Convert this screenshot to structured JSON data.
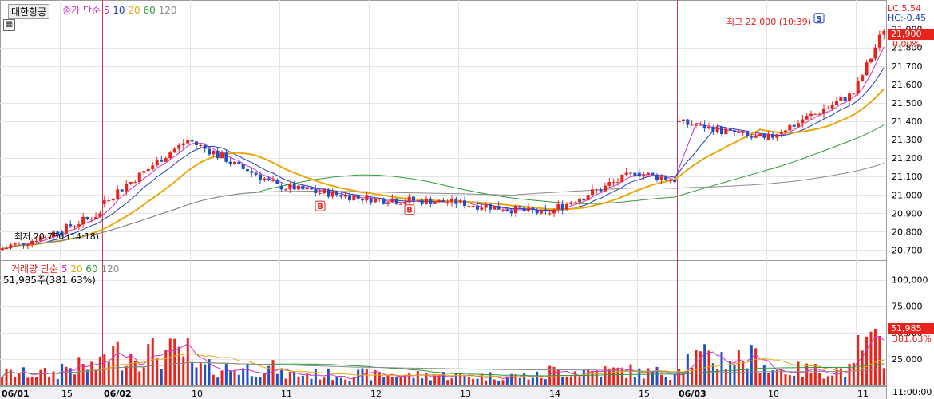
{
  "header": {
    "stock_name": "대한항공",
    "price_legend": {
      "prefix": "종가 단순",
      "ma": [
        "5",
        "10",
        "20",
        "60",
        "120"
      ]
    },
    "volume_legend": {
      "prefix": "거래량 단순",
      "ma": [
        "5",
        "20",
        "60",
        "120"
      ]
    },
    "volume_value": "51,985주(381.63%)",
    "lc": "LC:5.54",
    "hc": "HC:-0.45",
    "high_label": "최고 22,000 (10:39)",
    "low_label": "최저 20,750 (14:18)",
    "price_tag": "21,900",
    "pct_tag": "0.00%",
    "vol_tag": "51,985",
    "vol_pct_tag": "381.63%",
    "time_label": "11:00:00"
  },
  "colors": {
    "up": "#e8231c",
    "down": "#1f4fc4",
    "ma5": "#cc33cc",
    "ma10": "#1d3dbe",
    "ma20": "#e8a80c",
    "ma60": "#2d9a3c",
    "ma120": "#8a8a8a",
    "date_line": "#d9344a"
  },
  "chart_data": {
    "type": "candlestick",
    "price_axis": {
      "ticks": [
        "21,900",
        "21,800",
        "21,700",
        "21,600",
        "21,500",
        "21,400",
        "21,300",
        "21,200",
        "21,100",
        "21,000",
        "20,900",
        "20,800",
        "20,700"
      ],
      "range": [
        20650,
        22050
      ]
    },
    "volume_axis": {
      "ticks": [
        "100,000",
        "75,000",
        "50,000",
        "25,000"
      ],
      "range": [
        0,
        117000
      ]
    },
    "x_labels": [
      "06/01",
      "15",
      "06/02",
      "10",
      "11",
      "12",
      "13",
      "14",
      "15",
      "06/03",
      "10",
      "11"
    ],
    "day_separators": [
      "06/02",
      "06/03"
    ],
    "signals": [
      {
        "label": "B",
        "segment": "06/02 11"
      },
      {
        "label": "B",
        "segment": "06/02 12"
      },
      {
        "label": "S",
        "segment": "06/03 10"
      }
    ],
    "segments": [
      {
        "label": "06/01 14",
        "o": 20700,
        "c": 20800,
        "v": 14000
      },
      {
        "label": "06/01 15",
        "o": 20800,
        "c": 20900,
        "v": 22000
      },
      {
        "label": "06/02 09",
        "o": 20950,
        "c": 21300,
        "v": 38000
      },
      {
        "label": "06/02 10",
        "o": 21300,
        "c": 21050,
        "v": 20000
      },
      {
        "label": "06/02 11",
        "o": 21050,
        "c": 20980,
        "v": 13000
      },
      {
        "label": "06/02 12",
        "o": 20980,
        "c": 20960,
        "v": 12000
      },
      {
        "label": "06/02 13",
        "o": 20960,
        "c": 20900,
        "v": 11000
      },
      {
        "label": "06/02 14",
        "o": 20900,
        "c": 21120,
        "v": 17000
      },
      {
        "label": "06/02 15",
        "o": 21120,
        "c": 21080,
        "v": 15000
      },
      {
        "label": "06/03 09",
        "o": 21400,
        "c": 21300,
        "v": 32000
      },
      {
        "label": "06/03 10",
        "o": 21300,
        "c": 21550,
        "v": 18000
      },
      {
        "label": "06/03 11",
        "o": 21550,
        "c": 21900,
        "v": 45000
      }
    ]
  }
}
